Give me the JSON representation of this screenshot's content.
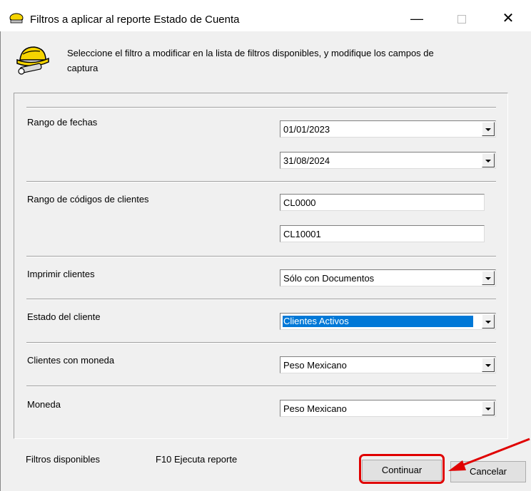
{
  "window": {
    "title": "Filtros a aplicar al reporte Estado de Cuenta",
    "minimize_glyph": "—",
    "close_glyph": "✕"
  },
  "header": {
    "icon": "hardhat-tool-icon",
    "instruction": "Seleccione el filtro a modificar  en la lista de filtros disponibles, y modifique los campos de  captura"
  },
  "filters": {
    "fechas": {
      "label": "Rango de fechas",
      "desde": "01/01/2023",
      "hasta": "31/08/2024"
    },
    "codigos": {
      "label": "Rango de códigos de clientes",
      "desde": "CL0000",
      "hasta": "CL10001"
    },
    "imprimir": {
      "label": "Imprimir clientes",
      "value": "Sólo con Documentos"
    },
    "estado": {
      "label": "Estado del cliente",
      "value": "Clientes Activos"
    },
    "moneda_clientes": {
      "label": "Clientes con moneda",
      "value": "Peso Mexicano"
    },
    "moneda": {
      "label": "Moneda",
      "value": "Peso Mexicano"
    }
  },
  "footer": {
    "disponibles": "Filtros disponibles",
    "f10": "F10 Ejecuta reporte",
    "continuar": "Continuar",
    "cancelar": "Cancelar"
  },
  "colors": {
    "selection": "#0078d7",
    "highlight": "#e00000"
  }
}
